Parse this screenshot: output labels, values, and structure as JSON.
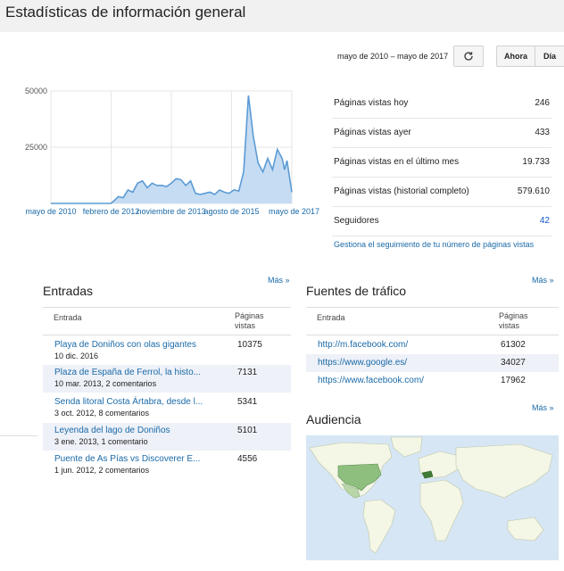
{
  "header": {
    "title": "Estadísticas de información general"
  },
  "controls": {
    "date_range": "mayo de 2010 – mayo de 2017",
    "refresh_icon": "refresh-icon",
    "now_label": "Ahora",
    "day_label": "Día"
  },
  "chart_data": {
    "type": "area",
    "x_ticks": [
      "mayo de 2010",
      "febrero de 2012",
      "noviembre de 2013",
      "agosto de 2015",
      "mayo de 2017"
    ],
    "y_ticks": [
      50000,
      25000
    ],
    "y_tick_labels": [
      "50000",
      "25000"
    ],
    "ylim": [
      0,
      50000
    ],
    "grid": true,
    "color": "#5b9bd5",
    "x": [
      0,
      0.05,
      0.1,
      0.15,
      0.2,
      0.25,
      0.28,
      0.3,
      0.32,
      0.34,
      0.36,
      0.38,
      0.4,
      0.42,
      0.44,
      0.46,
      0.48,
      0.5,
      0.52,
      0.54,
      0.56,
      0.58,
      0.6,
      0.62,
      0.64,
      0.66,
      0.68,
      0.7,
      0.72,
      0.74,
      0.76,
      0.78,
      0.8,
      0.82,
      0.84,
      0.86,
      0.88,
      0.9,
      0.92,
      0.94,
      0.96,
      0.97,
      0.98,
      1.0
    ],
    "y": [
      0,
      0,
      0,
      0,
      0,
      0,
      3000,
      2500,
      6000,
      5000,
      9000,
      10000,
      7000,
      9000,
      8000,
      8000,
      7500,
      9000,
      11000,
      10500,
      8000,
      10000,
      4500,
      4000,
      4500,
      5000,
      4000,
      6000,
      5000,
      4500,
      6000,
      5500,
      14000,
      48000,
      30000,
      18000,
      14000,
      20000,
      15000,
      24000,
      20000,
      15000,
      19000,
      5000
    ]
  },
  "stats": [
    {
      "label": "Páginas vistas hoy",
      "value": "246",
      "link": false
    },
    {
      "label": "Páginas vistas ayer",
      "value": "433",
      "link": false
    },
    {
      "label": "Páginas vistas en el último mes",
      "value": "19.733",
      "link": false
    },
    {
      "label": "Páginas vistas (historial completo)",
      "value": "579.610",
      "link": false
    },
    {
      "label": "Seguidores",
      "value": "42",
      "link": true
    }
  ],
  "manage_link": "Gestiona el seguimiento de tu número de páginas vistas",
  "posts": {
    "more": "Más »",
    "title": "Entradas",
    "col_entry": "Entrada",
    "col_views": "Páginas vistas",
    "rows": [
      {
        "title": "Playa de Doniños con olas gigantes",
        "meta": "10 dic. 2016",
        "views": "10375"
      },
      {
        "title": "Plaza de España de Ferrol, la histo...",
        "meta": "10 mar. 2013, 2 comentarios",
        "views": "7131"
      },
      {
        "title": "Senda litoral Costa Ártabra, desde l...",
        "meta": "3 oct. 2012, 8 comentarios",
        "views": "5341"
      },
      {
        "title": "Leyenda del lago de Doniños",
        "meta": "3 ene. 2013, 1 comentario",
        "views": "5101"
      },
      {
        "title": "Puente de As Pías vs Discoverer E...",
        "meta": "1 jun. 2012, 2 comentarios",
        "views": "4556"
      }
    ]
  },
  "traffic": {
    "more": "Más »",
    "title": "Fuentes de tráfico",
    "col_entry": "Entrada",
    "col_views": "Páginas vistas",
    "rows": [
      {
        "source": "http://m.facebook.com/",
        "views": "61302"
      },
      {
        "source": "https://www.google.es/",
        "views": "34027"
      },
      {
        "source": "https://www.facebook.com/",
        "views": "17962"
      }
    ]
  },
  "audience": {
    "more": "Más »",
    "title": "Audiencia",
    "colors": {
      "water": "#d6e6f4",
      "land": "#f4f6e6",
      "medium": "#8fbf7f",
      "strong": "#3e7c35"
    }
  }
}
